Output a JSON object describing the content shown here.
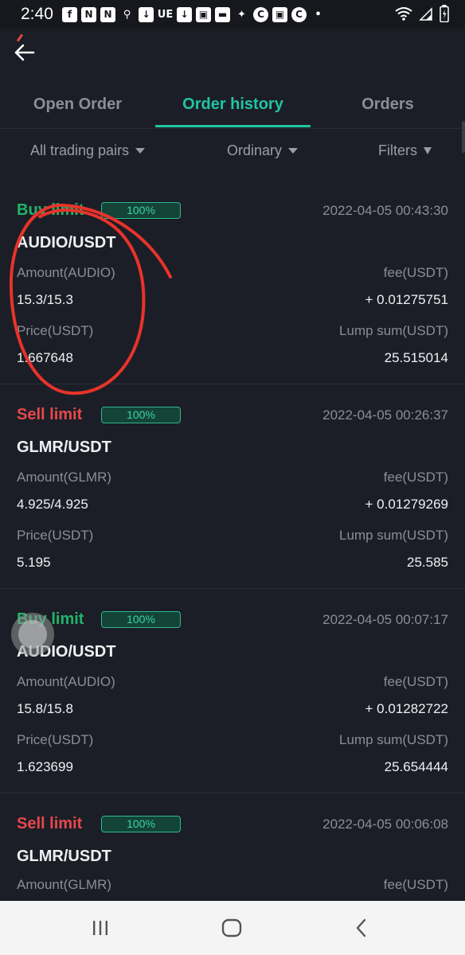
{
  "status_bar": {
    "time": "2:40",
    "carrier_text": "UE"
  },
  "tabs": [
    {
      "label": "Open Order",
      "active": false
    },
    {
      "label": "Order history",
      "active": true
    },
    {
      "label": "Orders",
      "active": false
    }
  ],
  "filters": {
    "pairs": "All trading pairs",
    "type": "Ordinary",
    "filters": "Filters"
  },
  "labels": {
    "fee": "fee(USDT)",
    "price": "Price(USDT)",
    "lump_sum": "Lump sum(USDT)"
  },
  "orders": [
    {
      "side": "Buy limit",
      "side_type": "buy",
      "fill": "100%",
      "time": "2022-04-05 00:43:30",
      "pair": "AUDIO/USDT",
      "amount_label": "Amount(AUDIO)",
      "amount": "15.3/15.3",
      "fee": "+ 0.01275751",
      "price": "1.667648",
      "lump_sum": "25.515014"
    },
    {
      "side": "Sell limit",
      "side_type": "sell",
      "fill": "100%",
      "time": "2022-04-05 00:26:37",
      "pair": "GLMR/USDT",
      "amount_label": "Amount(GLMR)",
      "amount": "4.925/4.925",
      "fee": "+ 0.01279269",
      "price": "5.195",
      "lump_sum": "25.585"
    },
    {
      "side": "Buy limit",
      "side_type": "buy",
      "fill": "100%",
      "time": "2022-04-05 00:07:17",
      "pair": "AUDIO/USDT",
      "amount_label": "Amount(AUDIO)",
      "amount": "15.8/15.8",
      "fee": "+ 0.01282722",
      "price": "1.623699",
      "lump_sum": "25.654444"
    },
    {
      "side": "Sell limit",
      "side_type": "sell",
      "fill": "100%",
      "time": "2022-04-05 00:06:08",
      "pair": "GLMR/USDT",
      "amount_label": "Amount(GLMR)",
      "amount": "",
      "fee": "",
      "price": "",
      "lump_sum": ""
    }
  ],
  "colors": {
    "background": "#1b1e26",
    "accent": "#23c4a2",
    "buy": "#22b36a",
    "sell": "#e5484d",
    "annotation": "#e8332b"
  }
}
